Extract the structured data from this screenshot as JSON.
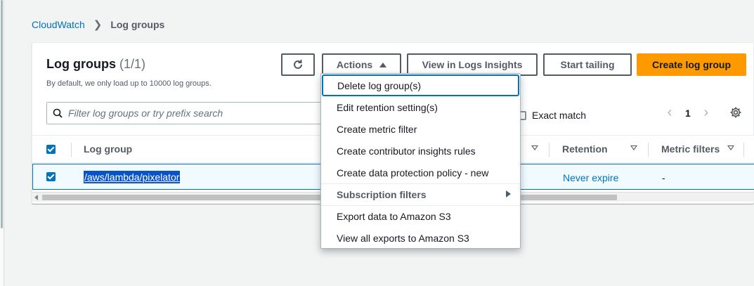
{
  "breadcrumb": {
    "parent": "CloudWatch",
    "current": "Log groups"
  },
  "panel": {
    "title": "Log groups",
    "count": "(1/1)",
    "description": "By default, we only load up to 10000 log groups."
  },
  "toolbar": {
    "actions_label": "Actions",
    "insights_label": "View in Logs Insights",
    "tail_label": "Start tailing",
    "create_label": "Create log group"
  },
  "search": {
    "placeholder": "Filter log groups or try prefix search",
    "value": ""
  },
  "exact_match": {
    "label": "Exact match",
    "checked": false
  },
  "pagination": {
    "current_page": "1"
  },
  "table": {
    "columns": {
      "log_group": "Log group",
      "retention": "Retention",
      "metric_filters": "Metric filters"
    },
    "rows": [
      {
        "log_group": "/aws/lambda/pixelator",
        "retention": "Never expire",
        "metric_filters": "-",
        "selected": true
      }
    ]
  },
  "actions_menu": {
    "items": [
      "Delete log group(s)",
      "Edit retention setting(s)",
      "Create metric filter",
      "Create contributor insights rules",
      "Create data protection policy - new"
    ],
    "subscription_group": "Subscription filters",
    "export_items": [
      "Export data to Amazon S3",
      "View all exports to Amazon S3"
    ]
  },
  "colors": {
    "primary": "#ff9900",
    "link": "#0073bb",
    "selection": "#0a53c6"
  }
}
